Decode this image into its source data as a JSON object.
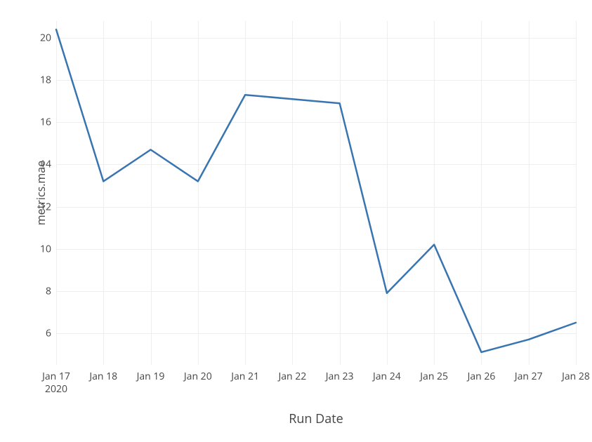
{
  "chart_data": {
    "type": "line",
    "xlabel": "Run Date",
    "ylabel": "metrics.mae",
    "x_tick_labels": [
      "Jan 17",
      "Jan 18",
      "Jan 19",
      "Jan 20",
      "Jan 21",
      "Jan 22",
      "Jan 23",
      "Jan 24",
      "Jan 25",
      "Jan 26",
      "Jan 27",
      "Jan 28"
    ],
    "x_year_label": "2020",
    "y_tick_labels": [
      "6",
      "8",
      "10",
      "12",
      "14",
      "16",
      "18",
      "20"
    ],
    "y_tick_values": [
      6,
      8,
      10,
      12,
      14,
      16,
      18,
      20
    ],
    "ylim": [
      4.5,
      20.8
    ],
    "series": [
      {
        "name": "metrics.mae",
        "x": [
          "Jan 17",
          "Jan 18",
          "Jan 19",
          "Jan 20",
          "Jan 21",
          "Jan 22",
          "Jan 23",
          "Jan 24",
          "Jan 25",
          "Jan 26",
          "Jan 27",
          "Jan 28"
        ],
        "values": [
          20.4,
          13.2,
          14.7,
          13.2,
          17.3,
          17.1,
          16.9,
          7.9,
          10.2,
          5.1,
          5.7,
          6.5
        ]
      }
    ],
    "line_color": "#3875b0"
  }
}
